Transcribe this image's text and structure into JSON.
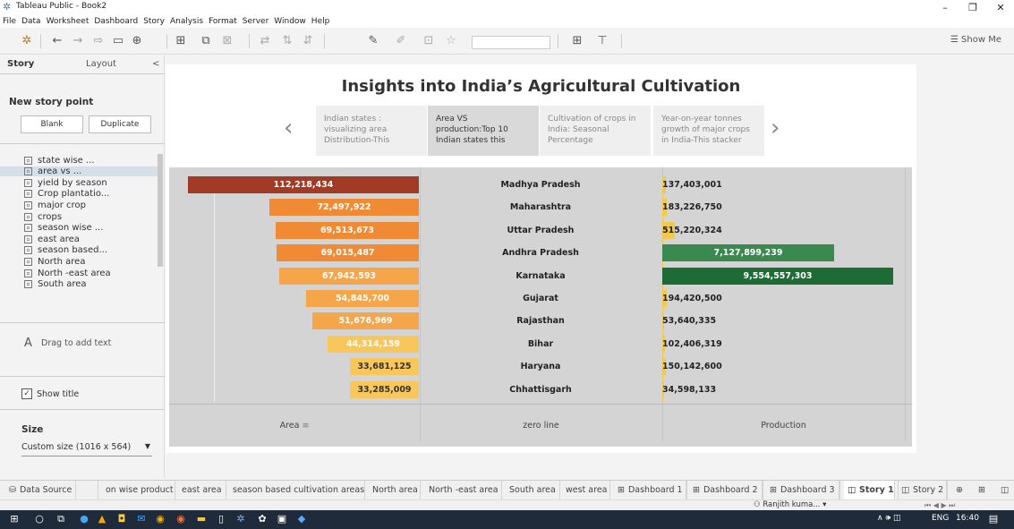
{
  "window": {
    "title": "Tableau Public - Book2",
    "minimize_glyph": "–",
    "restore_glyph": "❐",
    "close_glyph": "✕"
  },
  "menu": [
    "File",
    "Data",
    "Worksheet",
    "Dashboard",
    "Story",
    "Analysis",
    "Format",
    "Server",
    "Window",
    "Help"
  ],
  "toolbar": {
    "show_me_label": "Show Me"
  },
  "left_panel": {
    "tab_story": "Story",
    "tab_layout": "Layout",
    "collapse_glyph": "<",
    "new_story_point": "New story point",
    "blank_button": "Blank",
    "duplicate_button": "Duplicate",
    "sheets": [
      {
        "label": "state wise ...",
        "icon": "dashboard-icon"
      },
      {
        "label": "area vs ...",
        "icon": "dashboard-icon"
      },
      {
        "label": "yield by season",
        "icon": "sheet-icon"
      },
      {
        "label": "Crop plantatio...",
        "icon": "sheet-icon"
      },
      {
        "label": "major crop",
        "icon": "dashboard-icon"
      },
      {
        "label": "crops",
        "icon": "sheet-icon"
      },
      {
        "label": "season wise ...",
        "icon": "sheet-icon"
      },
      {
        "label": "east area",
        "icon": "sheet-icon"
      },
      {
        "label": "season based...",
        "icon": "dashboard-icon"
      },
      {
        "label": "North area",
        "icon": "sheet-icon"
      },
      {
        "label": "North -east area",
        "icon": "sheet-icon"
      },
      {
        "label": "South area",
        "icon": "sheet-icon"
      }
    ],
    "drag_text_icon": "A",
    "drag_text_label": "Drag to add text",
    "show_title_label": "Show title",
    "size_heading": "Size",
    "size_value": "Custom size (1016 x 564)"
  },
  "story": {
    "title": "Insights into India’s Agricultural Cultivation",
    "points": [
      {
        "line1": "Indian states :",
        "line2": "visualizing area",
        "line3": "Distribution-This"
      },
      {
        "line1": "Area VS",
        "line2": "production:Top 10",
        "line3": "Indian states this"
      },
      {
        "line1": "Cultivation of crops in",
        "line2": "India: Seasonal",
        "line3": "Percentage"
      },
      {
        "line1": "Year-on-year tonnes",
        "line2": "growth of major crops",
        "line3": "in India-This stacker"
      }
    ],
    "prev_glyph": "‹",
    "next_glyph": "›"
  },
  "chart_data": {
    "type": "bar",
    "categories": [
      "Madhya Pradesh",
      "Maharashtra",
      "Uttar Pradesh",
      "Andhra Pradesh",
      "Karnataka",
      "Gujarat",
      "Rajasthan",
      "Bihar",
      "Haryana",
      "Chhattisgarh"
    ],
    "series": [
      {
        "name": "Area",
        "values": [
          112218434,
          72497922,
          69513673,
          69015487,
          67942593,
          54845700,
          51676969,
          44314159,
          33681125,
          33285009
        ],
        "labels": [
          "112,218,434",
          "72,497,922",
          "69,513,673",
          "69,015,487",
          "67,942,593",
          "54,845,700",
          "51,676,969",
          "44,314,159",
          "33,681,125",
          "33,285,009"
        ]
      },
      {
        "name": "Production",
        "values": [
          137403001,
          183226750,
          515220324,
          7127899239,
          9554557303,
          194420500,
          53640335,
          102406319,
          150142600,
          34598133
        ],
        "labels": [
          "137,403,001",
          "183,226,750",
          "515,220,324",
          "7,127,899,239",
          "9,554,557,303",
          "194,420,500",
          "53,640,335",
          "102,406,319",
          "150,142,600",
          "34,598,133"
        ]
      }
    ],
    "column_headers": {
      "area": "Area",
      "middle": "zero line",
      "production": "Production"
    },
    "colors": {
      "area_gradient": [
        "#a23b26",
        "#e8732a",
        "#f08a35",
        "#f6a64a",
        "#f7c75c"
      ],
      "production_low": "#f2c94c",
      "production_mid": "#3a8a4f",
      "production_high": "#1d6b35",
      "background": "#d4d4d4"
    }
  },
  "tabs": [
    "Data Source",
    "on wise product",
    "east area",
    "season based cultivation areas",
    "North area",
    "North -east area",
    "South area",
    "west area",
    "Dashboard 1",
    "Dashboard 2",
    "Dashboard 3",
    "Story 1",
    "Story 2"
  ],
  "active_tab": "Story 1",
  "status": {
    "user": "Ranjith kuma..."
  },
  "taskbar": {
    "lang": "ENG",
    "time": "16:40"
  }
}
